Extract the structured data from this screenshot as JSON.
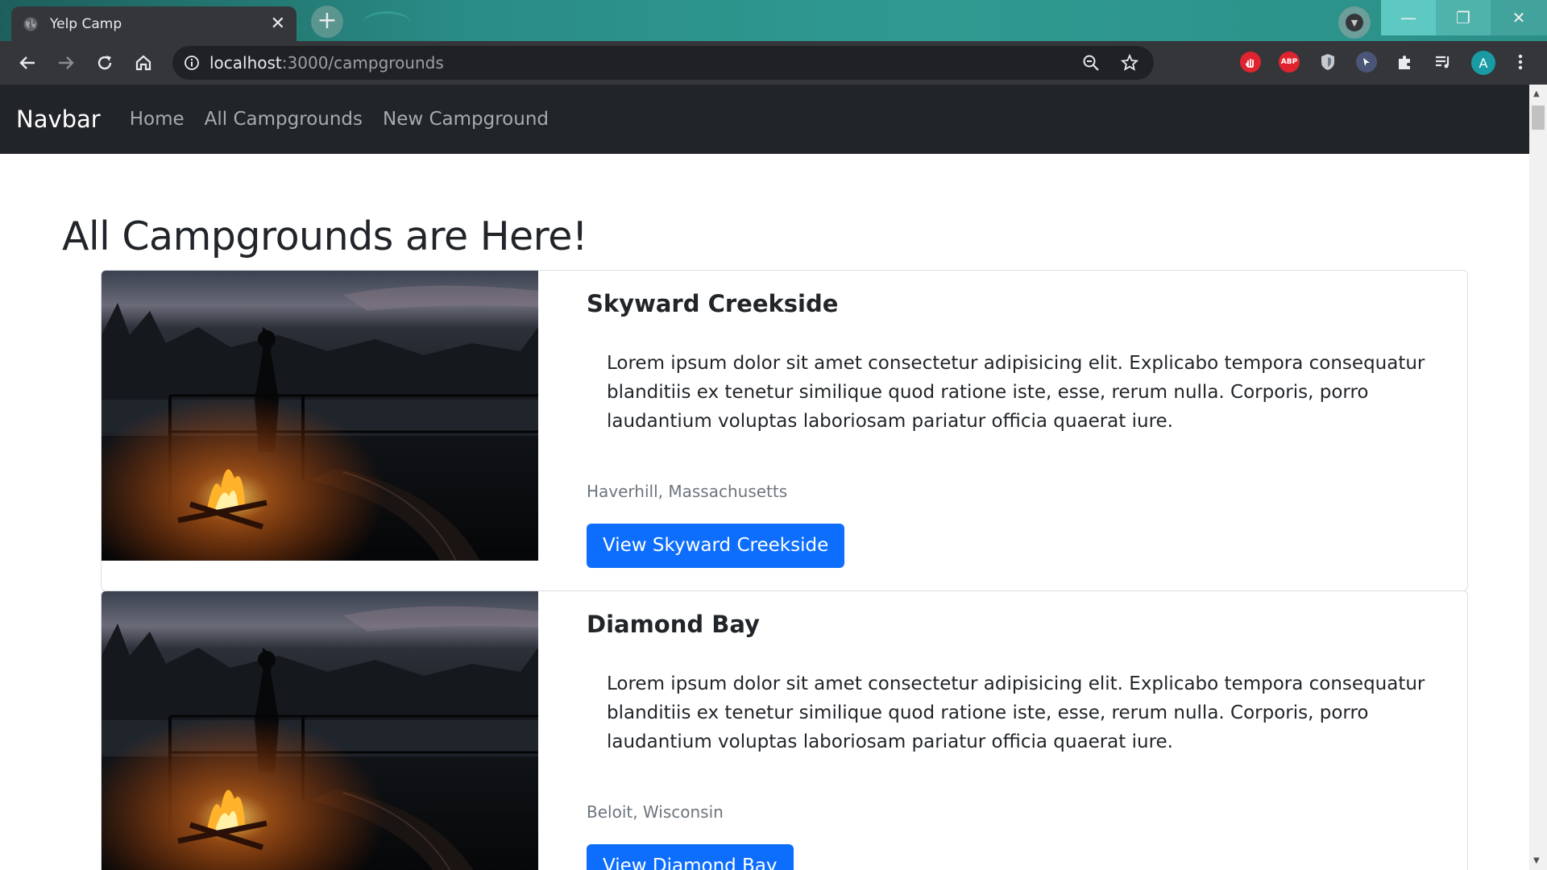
{
  "browser": {
    "tab_title": "Yelp Camp",
    "tab_close": "✕",
    "new_tab": "+",
    "url_host": "localhost",
    "url_rest": ":3000/campgrounds",
    "window_controls": {
      "minimize": "—",
      "maximize": "❐",
      "close": "✕"
    },
    "extensions": [
      {
        "name": "ublock-icon",
        "label": "",
        "color": "#e0242f"
      },
      {
        "name": "adblock-plus-icon",
        "label": "ABP",
        "color": "#e0242f"
      },
      {
        "name": "shield-icon",
        "label": "",
        "color": "#c6cacd"
      },
      {
        "name": "cursor-extension-icon",
        "label": "",
        "color": "#4a5578"
      },
      {
        "name": "puzzle-icon",
        "label": "",
        "color": "#e8eaed"
      },
      {
        "name": "media-queue-icon",
        "label": "",
        "color": "#e8eaed"
      }
    ],
    "avatar": "A",
    "accent_color": "#2a8c86"
  },
  "navbar": {
    "brand": "Navbar",
    "links": [
      "Home",
      "All Campgrounds",
      "New Campground"
    ]
  },
  "page": {
    "heading": "All Campgrounds are Here!"
  },
  "campgrounds": [
    {
      "title": "Skyward Creekside",
      "description": "Lorem ipsum dolor sit amet consectetur adipisicing elit. Explicabo tempora consequatur blanditiis ex tenetur similique quod ratione iste, esse, rerum nulla. Corporis, porro laudantium voluptas laboriosam pariatur officia quaerat iure.",
      "location": "Haverhill, Massachusetts",
      "button": "View Skyward Creekside"
    },
    {
      "title": "Diamond Bay",
      "description": "Lorem ipsum dolor sit amet consectetur adipisicing elit. Explicabo tempora consequatur blanditiis ex tenetur similique quod ratione iste, esse, rerum nulla. Corporis, porro laudantium voluptas laboriosam pariatur officia quaerat iure.",
      "location": "Beloit, Wisconsin",
      "button": "View Diamond Bay"
    }
  ],
  "colors": {
    "navbar_bg": "#212529",
    "primary_button": "#0d6efd",
    "muted_text": "#6c757d"
  }
}
